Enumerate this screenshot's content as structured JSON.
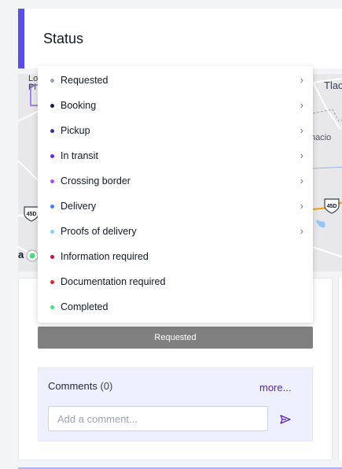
{
  "status": {
    "title": "Status",
    "accent": "#5b4cf0"
  },
  "map": {
    "labels": {
      "tlac": "Tlac",
      "lo": "Lo",
      "pi": "Pi",
      "nacio": "nacio",
      "a": "a"
    },
    "route_shields": [
      "45D",
      "45D"
    ]
  },
  "dropdown": {
    "items": [
      {
        "label": "Requested",
        "dot_color": "#9ca3af",
        "has_submenu": true
      },
      {
        "label": "Booking",
        "dot_color": "#1e1b4b",
        "has_submenu": true
      },
      {
        "label": "Pickup",
        "dot_color": "#3730a3",
        "has_submenu": true
      },
      {
        "label": "In transit",
        "dot_color": "#6d28d9",
        "has_submenu": true
      },
      {
        "label": "Crossing border",
        "dot_color": "#a855f7",
        "has_submenu": true
      },
      {
        "label": "Delivery",
        "dot_color": "#3b82f6",
        "has_submenu": true
      },
      {
        "label": "Proofs of delivery",
        "dot_color": "#7dd3fc",
        "has_submenu": true
      },
      {
        "label": "Information required",
        "dot_color": "#be123c",
        "has_submenu": false
      },
      {
        "label": "Documentation required",
        "dot_color": "#dc2626",
        "has_submenu": false
      },
      {
        "label": "Completed",
        "dot_color": "#4ade80",
        "has_submenu": false
      }
    ]
  },
  "status_bar": {
    "label": "Requested",
    "color": "#808080"
  },
  "comments": {
    "title": "Comments",
    "count": "(0)",
    "more_label": "more...",
    "input_placeholder": "Add a comment...",
    "send_icon": "send-icon"
  }
}
